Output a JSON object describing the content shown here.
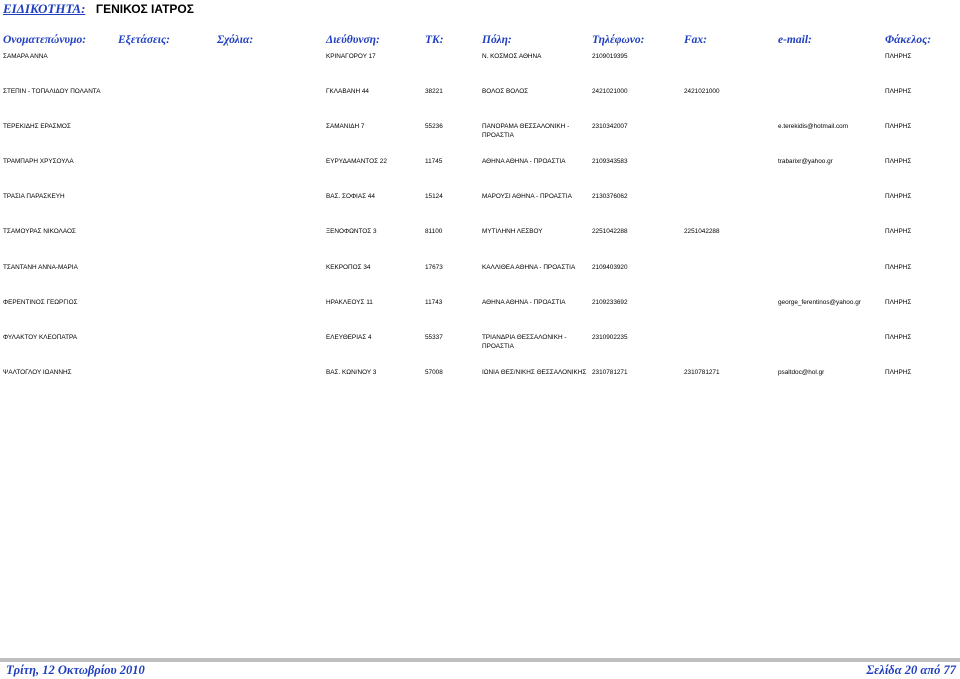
{
  "title": {
    "label": "ΕΙΔΙΚΟΤΗΤΑ:",
    "value": "ΓΕΝΙΚΟΣ ΙΑΤΡΟΣ"
  },
  "columns": [
    "Ονοματεπώνυμο:",
    "Εξετάσεις:",
    "Σχόλια:",
    "Διεύθυνση:",
    "ΤΚ:",
    "Πόλη:",
    "Τηλέφωνο:",
    "Fax:",
    "e-mail:",
    "Φάκελος:"
  ],
  "rows": [
    {
      "name": "ΣΑΜΑΡΑ ΑΝΝΑ",
      "address": "ΚΡΙΝΑΓΟΡΟΥ 17",
      "tk": "",
      "city": "Ν. ΚΟΣΜΟΣ ΑΘΗΝΑ",
      "phone": "2109019395",
      "fax": "",
      "email": "",
      "folder": "ΠΛΗΡΗΣ"
    },
    {
      "name": "ΣΤΕΠΙΝ - ΤΟΠΑΛΙΔΟΥ ΠΟΛΑΝΤΑ",
      "address": "ΓΚΛΑΒΑΝΗ 44",
      "tk": "38221",
      "city": "ΒΟΛΟΣ ΒΟΛΟΣ",
      "phone": "2421021000",
      "fax": "2421021000",
      "email": "",
      "folder": "ΠΛΗΡΗΣ"
    },
    {
      "name": "ΤΕΡΕΚΙΔΗΣ ΕΡΑΣΜΟΣ",
      "address": "ΣΑΜΑΝΙΔΗ 7",
      "tk": "55236",
      "city": "ΠΑΝΟΡΑΜΑ ΘΕΣΣΑΛΟΝΙΚΗ - ΠΡΟΑΣΤΙΑ",
      "phone": "2310342007",
      "fax": "",
      "email": "e.terekidis@hotmail.com",
      "folder": "ΠΛΗΡΗΣ"
    },
    {
      "name": "ΤΡΑΜΠΑΡΗ ΧΡΥΣΟΥΛΑ",
      "address": "ΕΥΡΥΔΑΜΑΝΤΟΣ 22",
      "tk": "11745",
      "city": "ΑΘΗΝΑ ΑΘΗΝΑ - ΠΡΟΑΣΤΙΑ",
      "phone": "2109343583",
      "fax": "",
      "email": "trabarixr@yahoo.gr",
      "folder": "ΠΛΗΡΗΣ"
    },
    {
      "name": "ΤΡΑΣΙΑ ΠΑΡΑΣΚΕΥΗ",
      "address": "ΒΑΣ. ΣΟΦΙΑΣ 44",
      "tk": "15124",
      "city": "ΜΑΡΟΥΣΙ ΑΘΗΝΑ - ΠΡΟΑΣΤΙΑ",
      "phone": "2130376062",
      "fax": "",
      "email": "",
      "folder": "ΠΛΗΡΗΣ"
    },
    {
      "name": "ΤΣΑΜΟΥΡΑΣ ΝΙΚΟΛΑΟΣ",
      "address": "ΞΕΝΟΦΩΝΤΟΣ 3",
      "tk": "81100",
      "city": "ΜΥΤΙΛΗΝΗ ΛΕΣΒΟΥ",
      "phone": "2251042288",
      "fax": "2251042288",
      "email": "",
      "folder": "ΠΛΗΡΗΣ"
    },
    {
      "name": "ΤΣΑΝΤΑΝΗ ΑΝΝΑ-ΜΑΡΙΑ",
      "address": "ΚΕΚΡΟΠΟΣ 34",
      "tk": "17673",
      "city": "ΚΑΛΛΙΘΕΑ ΑΘΗΝΑ - ΠΡΟΑΣΤΙΑ",
      "phone": "2109403920",
      "fax": "",
      "email": "",
      "folder": "ΠΛΗΡΗΣ"
    },
    {
      "name": "ΦΕΡΕΝΤΙΝΟΣ ΓΕΩΡΓΙΟΣ",
      "address": "ΗΡΑΚΛΕΟΥΣ 11",
      "tk": "11743",
      "city": "ΑΘΗΝΑ ΑΘΗΝΑ - ΠΡΟΑΣΤΙΑ",
      "phone": "2109233692",
      "fax": "",
      "email": "george_ferentinos@yahoo.gr",
      "folder": "ΠΛΗΡΗΣ"
    },
    {
      "name": "ΦΥΛΑΚΤΟΥ ΚΛΕΟΠΑΤΡΑ",
      "address": "ΕΛΕΥΘΕΡΙΑΣ 4",
      "tk": "55337",
      "city": "ΤΡΙΑΝΔΡΙΑ ΘΕΣΣΑΛΟΝΙΚΗ - ΠΡΟΑΣΤΙΑ",
      "phone": "2310902235",
      "fax": "",
      "email": "",
      "folder": "ΠΛΗΡΗΣ"
    },
    {
      "name": "ΨΑΛΤΟΓΛΟΥ ΙΩΑΝΝΗΣ",
      "address": "ΒΑΣ. ΚΩΝ/ΝΟΥ 3",
      "tk": "57008",
      "city": "ΙΩΝΙΑ ΘΕΣ/ΝΙΚΗΣ ΘΕΣΣΑΛΟΝΙΚΗΣ",
      "phone": "2310781271",
      "fax": "2310781271",
      "email": "psaltdoc@hol.gr",
      "folder": "ΠΛΗΡΗΣ"
    }
  ],
  "footer": {
    "date": "Τρίτη, 12 Οκτωβρίου 2010",
    "page": "Σελίδα 20 από 77"
  }
}
